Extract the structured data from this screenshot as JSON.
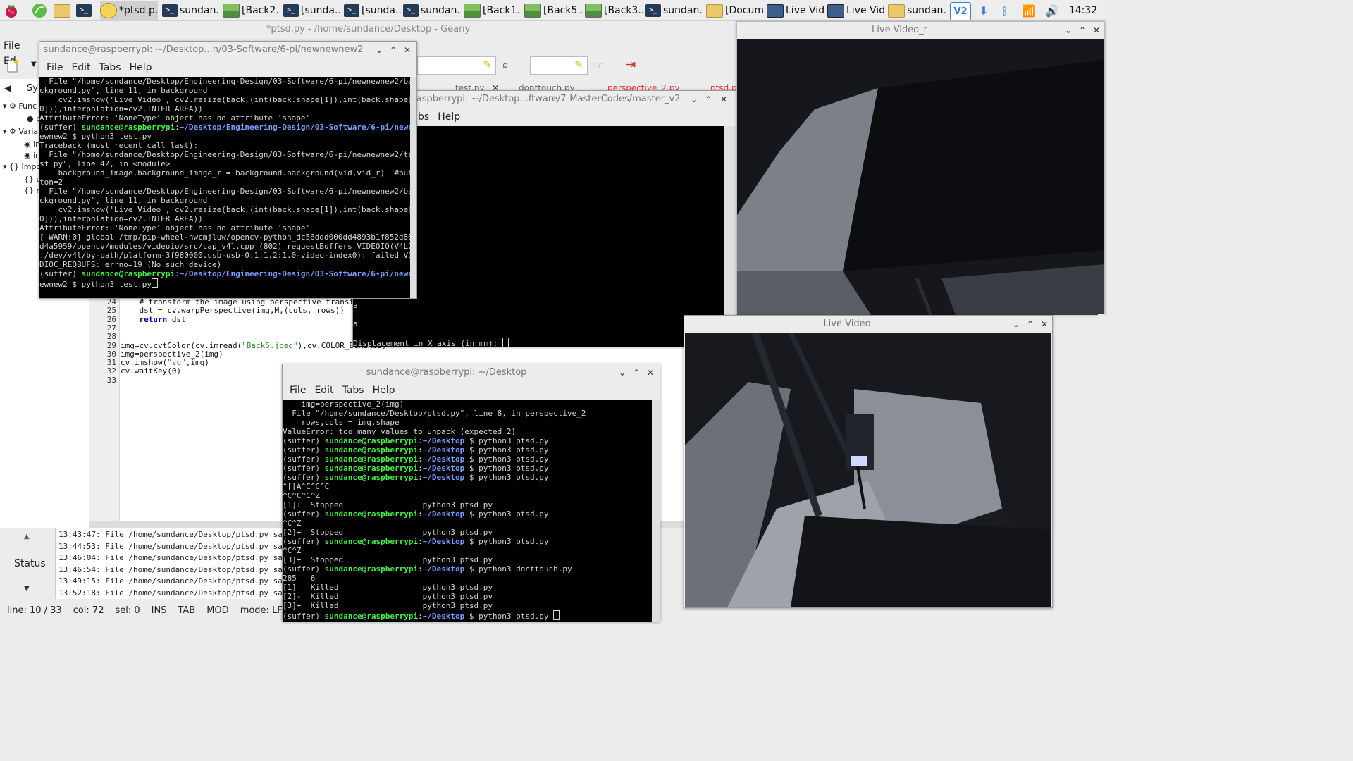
{
  "taskbar": {
    "buttons": [
      {
        "label": "",
        "icon": "terminal-icon"
      },
      {
        "label": "*ptsd.p...",
        "icon": "geany-icon"
      },
      {
        "label": "sundan...",
        "icon": "terminal-icon"
      },
      {
        "label": "[Back2....",
        "icon": "image-viewer-icon"
      },
      {
        "label": "[sunda...",
        "icon": "terminal-icon"
      },
      {
        "label": "[sunda...",
        "icon": "terminal-icon"
      },
      {
        "label": "sundan...",
        "icon": "terminal-icon"
      },
      {
        "label": "[Back1....",
        "icon": "image-viewer-icon"
      },
      {
        "label": "[Back5....",
        "icon": "image-viewer-icon"
      },
      {
        "label": "[Back3....",
        "icon": "image-viewer-icon"
      },
      {
        "label": "sundan...",
        "icon": "terminal-icon"
      },
      {
        "label": "[Docum...",
        "icon": "folder-icon"
      },
      {
        "label": "Live Vid...",
        "icon": "video-window-icon"
      },
      {
        "label": "Live Vid...",
        "icon": "video-window-icon"
      },
      {
        "label": "sundan...",
        "icon": "folder-icon"
      }
    ],
    "clock": "14:32"
  },
  "geany": {
    "title": "*ptsd.py - /home/sundance/Desktop - Geany",
    "menu": [
      "File",
      "Ed"
    ],
    "sidebar": {
      "tab": "Sy",
      "items": [
        "Func",
        "p",
        "Varia",
        "in",
        "in",
        "Impo",
        "cl",
        "n"
      ]
    },
    "tabs": [
      "test.py",
      "donttouch.py",
      "perspective_2.py",
      "ptsd.p"
    ],
    "code_lines": [
      {
        "n": "24",
        "text": "    # transform the image using perspective transfo"
      },
      {
        "n": "25",
        "text": "    dst = cv.warpPerspective(img,M,(cols, rows))"
      },
      {
        "n": "26",
        "text": "    return dst"
      },
      {
        "n": "27",
        "text": ""
      },
      {
        "n": "28",
        "text": ""
      },
      {
        "n": "29",
        "text": "img=cv.cvtColor(cv.imread(\"Back5.jpeg\"),cv.COLOR_BGR2RGB)"
      },
      {
        "n": "30",
        "text": "img=perspective_2(img)"
      },
      {
        "n": "31",
        "text": "cv.imshow(\"su\",img)"
      },
      {
        "n": "32",
        "text": "cv.waitKey(0)"
      },
      {
        "n": "33",
        "text": ""
      }
    ],
    "messages": [
      "13:43:47: File /home/sundance/Desktop/ptsd.py saved.",
      "13:44:53: File /home/sundance/Desktop/ptsd.py saved.",
      "13:46:04: File /home/sundance/Desktop/ptsd.py saved.",
      "13:46:54: File /home/sundance/Desktop/ptsd.py saved.",
      "13:49:15: File /home/sundance/Desktop/ptsd.py saved.",
      "13:52:18: File /home/sundance/Desktop/ptsd.py saved."
    ],
    "message_tab": "Status",
    "status": {
      "line": "line: 10 / 33",
      "col": "col: 72",
      "sel": "sel: 0",
      "ins": "INS",
      "tab": "TAB",
      "mod": "MOD",
      "mode": "mode: LF"
    }
  },
  "term1": {
    "title": "sundance@raspberrypi: ~/Desktop...n/03-Software/6-pi/newnewnew2",
    "menu": [
      "File",
      "Edit",
      "Tabs",
      "Help"
    ],
    "lines": [
      "  File \"/home/sundance/Desktop/Engineering-Design/03-Software/6-pi/newnewnew2/ba",
      "ckground.py\", line 11, in background",
      "    cv2.imshow('Live Video', cv2.resize(back,(int(back.shape[1]),int(back.shape[",
      "0])),interpolation=cv2.INTER_AREA))",
      "AttributeError: 'NoneType' object has no attribute 'shape'",
      "(suffer) sundance@raspberrypi:~/Desktop/Engineering-Design/03-Software/6-pi/newn",
      "ewnew2 $ python3 test.py",
      "Traceback (most recent call last):",
      "  File \"/home/sundance/Desktop/Engineering-Design/03-Software/6-pi/newnewnew2/te",
      "st.py\", line 42, in <module>",
      "    background_image,background_image_r = background.background(vid,vid_r)  #but",
      "ton=2",
      "  File \"/home/sundance/Desktop/Engineering-Design/03-Software/6-pi/newnewnew2/ba",
      "ckground.py\", line 11, in background",
      "    cv2.imshow('Live Video', cv2.resize(back,(int(back.shape[1]),int(back.shape[",
      "0])),interpolation=cv2.INTER_AREA))",
      "AttributeError: 'NoneType' object has no attribute 'shape'",
      "[ WARN:0] global /tmp/pip-wheel-hwcmjluw/opencv-python_dc56ddd000dd4893b1f852d88",
      "d4a5959/opencv/modules/videoio/src/cap_v4l.cpp (802) requestBuffers VIDEOIO(V4L2",
      ":/dev/v4l/by-path/platform-3f980000.usb-usb-0:1.1.2:1.0-video-index0): failed VI",
      "DIOC_REQBUFS: errno=19 (No such device)",
      "(suffer) sundance@raspberrypi:~/Desktop/Engineering-Design/03-Software/6-pi/newn",
      "ewnew2 $ python3 test.py"
    ]
  },
  "term2": {
    "title": "sundance@raspberrypi: ~/Desktop...ftware/7-MasterCodes/master_v2",
    "menu": [
      "bs",
      "Help"
    ],
    "lines": [
      "a",
      "",
      "a",
      "",
      "Displacement in X axis (in mm): "
    ]
  },
  "term3": {
    "title": "sundance@raspberrypi: ~/Desktop",
    "menu": [
      "File",
      "Edit",
      "Tabs",
      "Help"
    ],
    "lines": [
      "    img=perspective_2(img)",
      "  File \"/home/sundance/Desktop/ptsd.py\", line 8, in perspective_2",
      "    rows,cols = img.shape",
      "ValueError: too many values to unpack (expected 2)",
      "(suffer) sundance@raspberrypi:~/Desktop $ python3 ptsd.py",
      "(suffer) sundance@raspberrypi:~/Desktop $ python3 ptsd.py",
      "(suffer) sundance@raspberrypi:~/Desktop $ python3 ptsd.py",
      "(suffer) sundance@raspberrypi:~/Desktop $ python3 ptsd.py",
      "(suffer) sundance@raspberrypi:~/Desktop $ python3 ptsd.py",
      "^[[A^C^C^C",
      "^C^C^C^Z",
      "[1]+  Stopped                 python3 ptsd.py",
      "(suffer) sundance@raspberrypi:~/Desktop $ python3 ptsd.py",
      "^C^Z",
      "[2]+  Stopped                 python3 ptsd.py",
      "(suffer) sundance@raspberrypi:~/Desktop $ python3 ptsd.py",
      "^C^Z",
      "[3]+  Stopped                 python3 ptsd.py",
      "(suffer) sundance@raspberrypi:~/Desktop $ python3 donttouch.py",
      "285   6",
      "[1]   Killed                  python3 ptsd.py",
      "[2]-  Killed                  python3 ptsd.py",
      "[3]+  Killed                  python3 ptsd.py",
      "(suffer) sundance@raspberrypi:~/Desktop $ python3 ptsd.py "
    ]
  },
  "video_r": {
    "title": "Live Video_r"
  },
  "video": {
    "title": "Live Video"
  },
  "colors": {
    "prompt_user": "#4ee94e",
    "prompt_path": "#7b9cff",
    "terminal_bg": "#000000",
    "terminal_fg": "#d3d7cf",
    "tray_blue": "#3b7fc8"
  }
}
